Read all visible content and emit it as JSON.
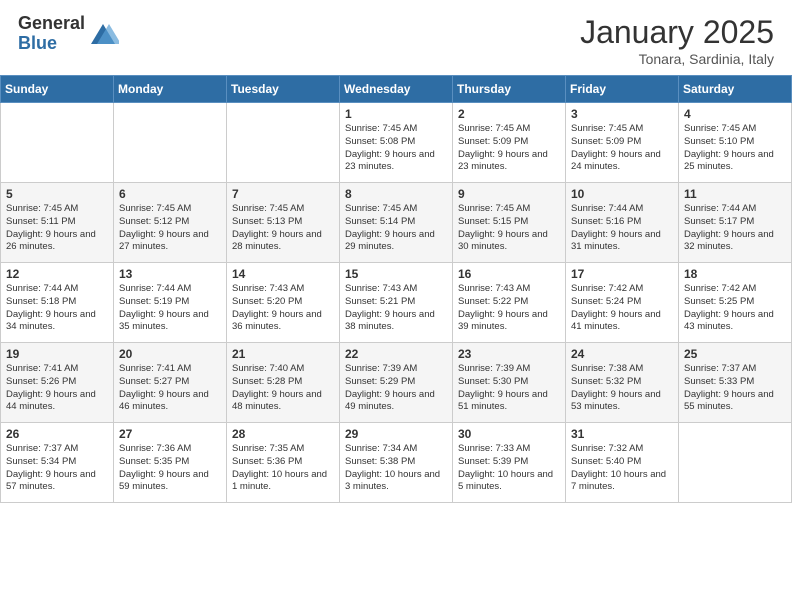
{
  "header": {
    "logo_general": "General",
    "logo_blue": "Blue",
    "title": "January 2025",
    "subtitle": "Tonara, Sardinia, Italy"
  },
  "weekdays": [
    "Sunday",
    "Monday",
    "Tuesday",
    "Wednesday",
    "Thursday",
    "Friday",
    "Saturday"
  ],
  "weeks": [
    [
      {
        "day": "",
        "info": ""
      },
      {
        "day": "",
        "info": ""
      },
      {
        "day": "",
        "info": ""
      },
      {
        "day": "1",
        "info": "Sunrise: 7:45 AM\nSunset: 5:08 PM\nDaylight: 9 hours and 23 minutes."
      },
      {
        "day": "2",
        "info": "Sunrise: 7:45 AM\nSunset: 5:09 PM\nDaylight: 9 hours and 23 minutes."
      },
      {
        "day": "3",
        "info": "Sunrise: 7:45 AM\nSunset: 5:09 PM\nDaylight: 9 hours and 24 minutes."
      },
      {
        "day": "4",
        "info": "Sunrise: 7:45 AM\nSunset: 5:10 PM\nDaylight: 9 hours and 25 minutes."
      }
    ],
    [
      {
        "day": "5",
        "info": "Sunrise: 7:45 AM\nSunset: 5:11 PM\nDaylight: 9 hours and 26 minutes."
      },
      {
        "day": "6",
        "info": "Sunrise: 7:45 AM\nSunset: 5:12 PM\nDaylight: 9 hours and 27 minutes."
      },
      {
        "day": "7",
        "info": "Sunrise: 7:45 AM\nSunset: 5:13 PM\nDaylight: 9 hours and 28 minutes."
      },
      {
        "day": "8",
        "info": "Sunrise: 7:45 AM\nSunset: 5:14 PM\nDaylight: 9 hours and 29 minutes."
      },
      {
        "day": "9",
        "info": "Sunrise: 7:45 AM\nSunset: 5:15 PM\nDaylight: 9 hours and 30 minutes."
      },
      {
        "day": "10",
        "info": "Sunrise: 7:44 AM\nSunset: 5:16 PM\nDaylight: 9 hours and 31 minutes."
      },
      {
        "day": "11",
        "info": "Sunrise: 7:44 AM\nSunset: 5:17 PM\nDaylight: 9 hours and 32 minutes."
      }
    ],
    [
      {
        "day": "12",
        "info": "Sunrise: 7:44 AM\nSunset: 5:18 PM\nDaylight: 9 hours and 34 minutes."
      },
      {
        "day": "13",
        "info": "Sunrise: 7:44 AM\nSunset: 5:19 PM\nDaylight: 9 hours and 35 minutes."
      },
      {
        "day": "14",
        "info": "Sunrise: 7:43 AM\nSunset: 5:20 PM\nDaylight: 9 hours and 36 minutes."
      },
      {
        "day": "15",
        "info": "Sunrise: 7:43 AM\nSunset: 5:21 PM\nDaylight: 9 hours and 38 minutes."
      },
      {
        "day": "16",
        "info": "Sunrise: 7:43 AM\nSunset: 5:22 PM\nDaylight: 9 hours and 39 minutes."
      },
      {
        "day": "17",
        "info": "Sunrise: 7:42 AM\nSunset: 5:24 PM\nDaylight: 9 hours and 41 minutes."
      },
      {
        "day": "18",
        "info": "Sunrise: 7:42 AM\nSunset: 5:25 PM\nDaylight: 9 hours and 43 minutes."
      }
    ],
    [
      {
        "day": "19",
        "info": "Sunrise: 7:41 AM\nSunset: 5:26 PM\nDaylight: 9 hours and 44 minutes."
      },
      {
        "day": "20",
        "info": "Sunrise: 7:41 AM\nSunset: 5:27 PM\nDaylight: 9 hours and 46 minutes."
      },
      {
        "day": "21",
        "info": "Sunrise: 7:40 AM\nSunset: 5:28 PM\nDaylight: 9 hours and 48 minutes."
      },
      {
        "day": "22",
        "info": "Sunrise: 7:39 AM\nSunset: 5:29 PM\nDaylight: 9 hours and 49 minutes."
      },
      {
        "day": "23",
        "info": "Sunrise: 7:39 AM\nSunset: 5:30 PM\nDaylight: 9 hours and 51 minutes."
      },
      {
        "day": "24",
        "info": "Sunrise: 7:38 AM\nSunset: 5:32 PM\nDaylight: 9 hours and 53 minutes."
      },
      {
        "day": "25",
        "info": "Sunrise: 7:37 AM\nSunset: 5:33 PM\nDaylight: 9 hours and 55 minutes."
      }
    ],
    [
      {
        "day": "26",
        "info": "Sunrise: 7:37 AM\nSunset: 5:34 PM\nDaylight: 9 hours and 57 minutes."
      },
      {
        "day": "27",
        "info": "Sunrise: 7:36 AM\nSunset: 5:35 PM\nDaylight: 9 hours and 59 minutes."
      },
      {
        "day": "28",
        "info": "Sunrise: 7:35 AM\nSunset: 5:36 PM\nDaylight: 10 hours and 1 minute."
      },
      {
        "day": "29",
        "info": "Sunrise: 7:34 AM\nSunset: 5:38 PM\nDaylight: 10 hours and 3 minutes."
      },
      {
        "day": "30",
        "info": "Sunrise: 7:33 AM\nSunset: 5:39 PM\nDaylight: 10 hours and 5 minutes."
      },
      {
        "day": "31",
        "info": "Sunrise: 7:32 AM\nSunset: 5:40 PM\nDaylight: 10 hours and 7 minutes."
      },
      {
        "day": "",
        "info": ""
      }
    ]
  ]
}
